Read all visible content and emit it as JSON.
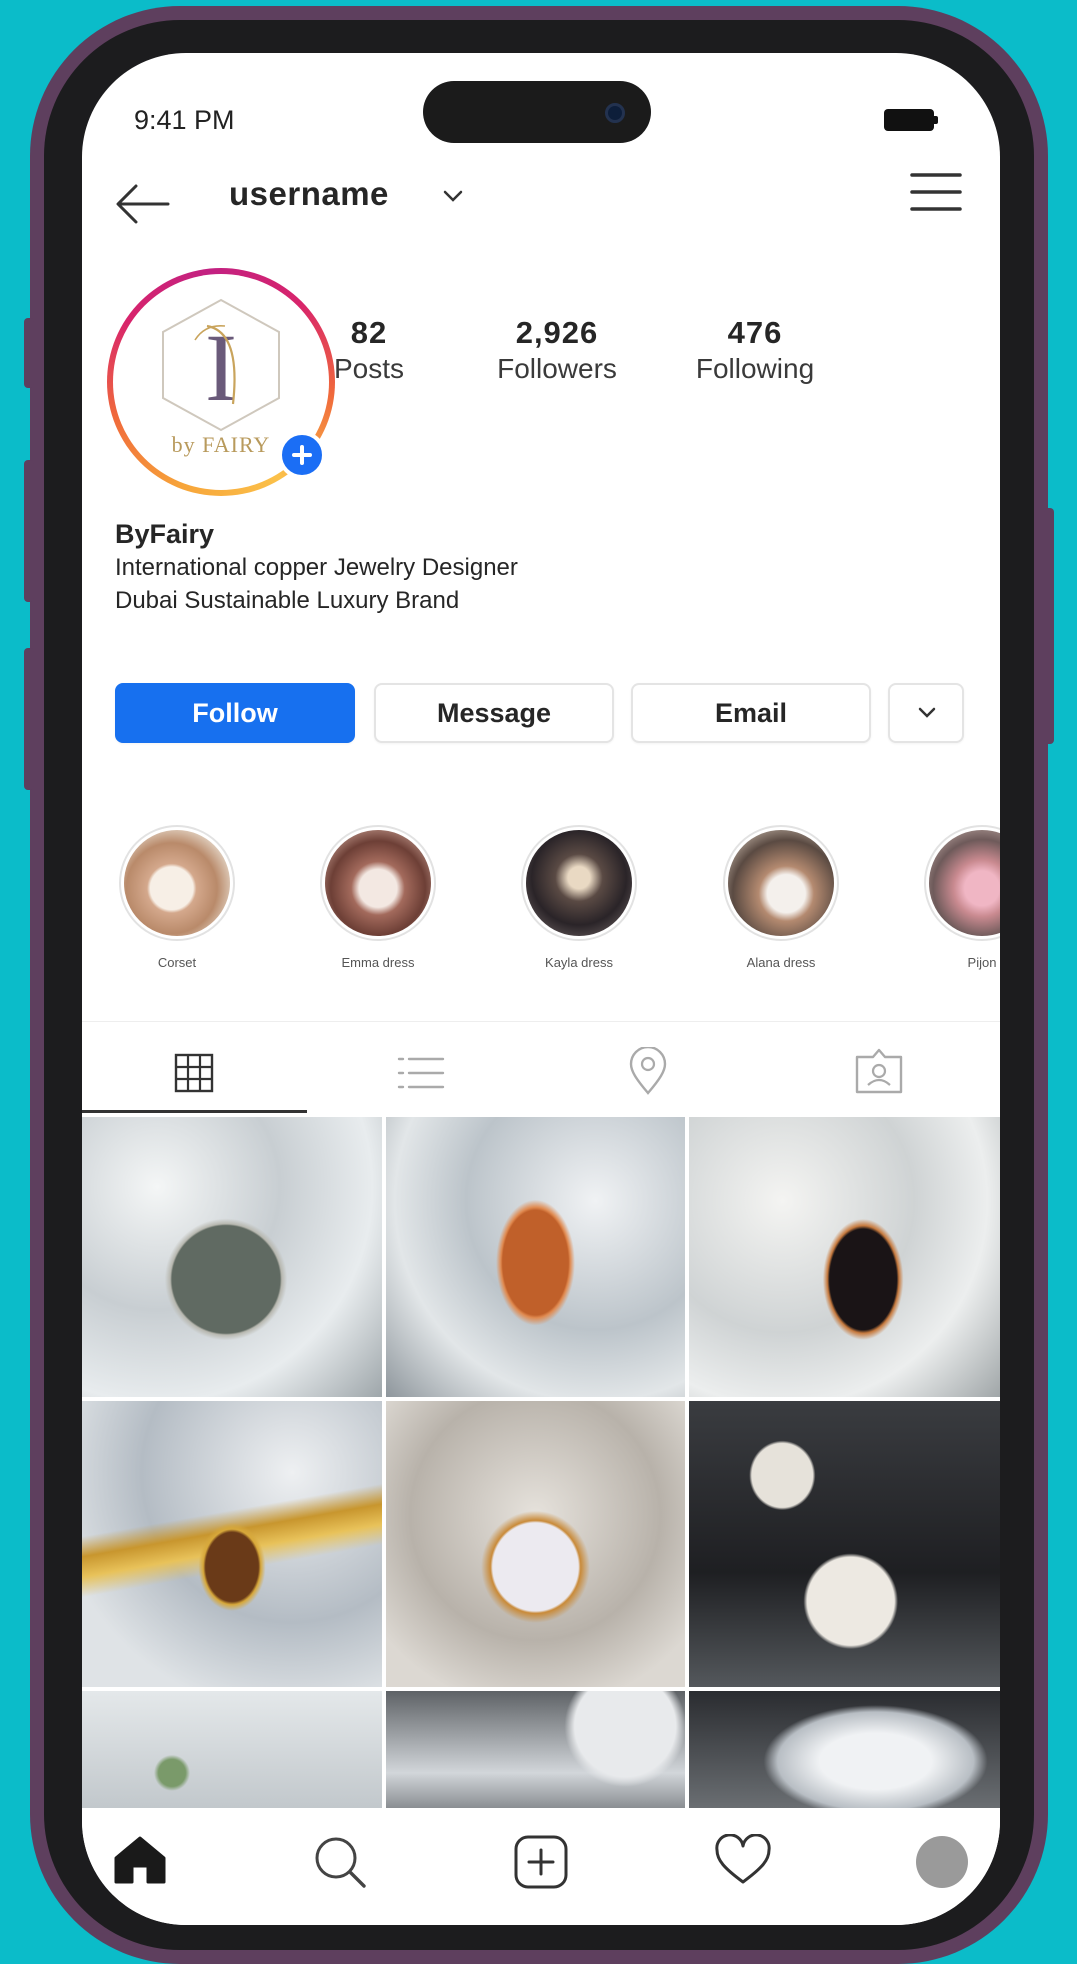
{
  "status_bar": {
    "time": "9:41 PM"
  },
  "header": {
    "username": "username"
  },
  "profile": {
    "avatar_logo_text": "by FAIRY",
    "stats": [
      {
        "value": "82",
        "label": "Posts"
      },
      {
        "value": "2,926",
        "label": "Followers"
      },
      {
        "value": "476",
        "label": "Following"
      }
    ],
    "name": "ByFairy",
    "bio_lines": [
      "International copper Jewelry Designer",
      "Dubai Sustainable Luxury Brand"
    ]
  },
  "actions": {
    "follow": "Follow",
    "message": "Message",
    "email": "Email"
  },
  "highlights": [
    {
      "label": "Corset"
    },
    {
      "label": "Emma dress"
    },
    {
      "label": "Kayla dress"
    },
    {
      "label": "Alana dress"
    },
    {
      "label": "Pijon"
    }
  ],
  "tabs": [
    "grid-icon",
    "list-icon",
    "location-pin-icon",
    "tagged-icon"
  ],
  "bottom_nav": [
    "home-icon",
    "search-icon",
    "add-post-icon",
    "heart-icon",
    "profile-avatar"
  ],
  "colors": {
    "background": "#0bbcc9",
    "phone_frame": "#5e3f5e",
    "follow_button": "#1770ef",
    "story_ring": "#d8246b"
  }
}
